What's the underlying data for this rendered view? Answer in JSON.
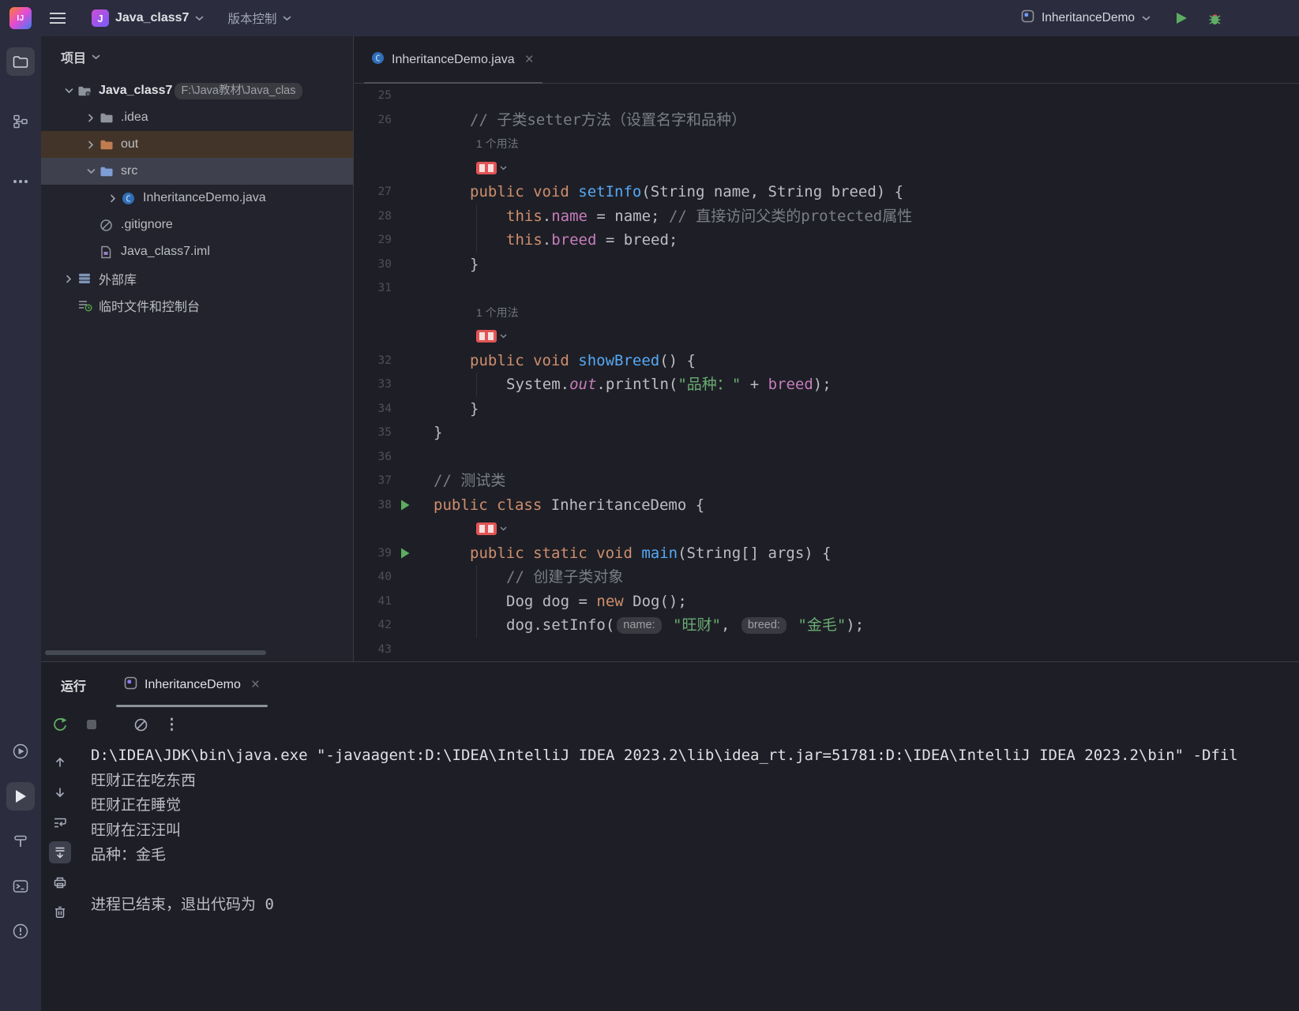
{
  "topbar": {
    "project": {
      "avatar_letter": "J",
      "label": "Java_class7"
    },
    "vcs_label": "版本控制",
    "run_widget": {
      "config_label": "InheritanceDemo"
    }
  },
  "tool_strip": {
    "top_icons": [
      "project-folder",
      "structure",
      "more-horizontal"
    ],
    "bottom_icons": [
      "services",
      "run",
      "build-hammer",
      "terminal",
      "problems"
    ]
  },
  "project_panel": {
    "title": "项目",
    "tree": [
      {
        "label": "Java_class7",
        "hint": "F:\\Java教材\\Java_clas",
        "icon": "folder-project",
        "chevron": "down",
        "indent": 0,
        "bold": true
      },
      {
        "label": ".idea",
        "icon": "folder",
        "chevron": "right",
        "indent": 1
      },
      {
        "label": "out",
        "icon": "folder-excluded",
        "chevron": "right",
        "indent": 1,
        "highlight": "hover"
      },
      {
        "label": "src",
        "icon": "folder-src",
        "chevron": "down",
        "indent": 1,
        "highlight": "selected"
      },
      {
        "label": "InheritanceDemo.java",
        "icon": "java-class",
        "chevron": "right",
        "indent": 2
      },
      {
        "label": ".gitignore",
        "icon": "gitignore",
        "indent": 1
      },
      {
        "label": "Java_class7.iml",
        "icon": "module-file",
        "indent": 1
      },
      {
        "label": "外部库",
        "icon": "libraries",
        "chevron": "right",
        "indent": 0
      },
      {
        "label": "临时文件和控制台",
        "icon": "scratches",
        "indent": 0
      }
    ]
  },
  "editor": {
    "tab": {
      "label": "InheritanceDemo.java"
    },
    "usage_hint": "1 个用法",
    "lines": [
      {
        "type": "code",
        "num": "25",
        "indent": 0,
        "tokens": []
      },
      {
        "type": "code",
        "num": "26",
        "indent": 1,
        "tokens": [
          [
            "co",
            "// 子类setter方法（设置名字和品种）"
          ]
        ]
      },
      {
        "type": "usage",
        "indent": 1
      },
      {
        "type": "badge",
        "indent": 1
      },
      {
        "type": "code",
        "num": "27",
        "indent": 1,
        "tokens": [
          [
            "kw",
            "public void "
          ],
          [
            "me",
            "setInfo"
          ],
          [
            "pl",
            "(String name, String breed) {"
          ]
        ]
      },
      {
        "type": "code",
        "num": "28",
        "indent": 2,
        "tokens": [
          [
            "kw",
            "this"
          ],
          [
            "pl",
            "."
          ],
          [
            "fi",
            "name"
          ],
          [
            "pl",
            " = name; "
          ],
          [
            "co",
            "// 直接访问父类的protected属性"
          ]
        ]
      },
      {
        "type": "code",
        "num": "29",
        "indent": 2,
        "tokens": [
          [
            "kw",
            "this"
          ],
          [
            "pl",
            "."
          ],
          [
            "fi",
            "breed"
          ],
          [
            "pl",
            " = breed;"
          ]
        ]
      },
      {
        "type": "code",
        "num": "30",
        "indent": 1,
        "tokens": [
          [
            "pl",
            "}"
          ]
        ]
      },
      {
        "type": "code",
        "num": "31",
        "indent": 0,
        "tokens": []
      },
      {
        "type": "usage",
        "indent": 1
      },
      {
        "type": "badge",
        "indent": 1
      },
      {
        "type": "code",
        "num": "32",
        "indent": 1,
        "tokens": [
          [
            "kw",
            "public void "
          ],
          [
            "me",
            "showBreed"
          ],
          [
            "pl",
            "() {"
          ]
        ]
      },
      {
        "type": "code",
        "num": "33",
        "indent": 2,
        "tokens": [
          [
            "pl",
            "System."
          ],
          [
            "fo",
            "out"
          ],
          [
            "pl",
            ".println("
          ],
          [
            "st",
            "\"品种："
          ],
          [
            "st",
            "\""
          ],
          [
            "pl",
            " + "
          ],
          [
            "fi",
            "breed"
          ],
          [
            "pl",
            ");"
          ]
        ]
      },
      {
        "type": "code",
        "num": "34",
        "indent": 1,
        "tokens": [
          [
            "pl",
            "}"
          ]
        ]
      },
      {
        "type": "code",
        "num": "35",
        "indent": 0,
        "tokens": [
          [
            "pl",
            "}"
          ]
        ]
      },
      {
        "type": "code",
        "num": "36",
        "indent": 0,
        "tokens": []
      },
      {
        "type": "code",
        "num": "37",
        "indent": 0,
        "tokens": [
          [
            "co",
            "// 测试类"
          ]
        ]
      },
      {
        "type": "code",
        "num": "38",
        "indent": 0,
        "run": true,
        "tokens": [
          [
            "kw",
            "public class "
          ],
          [
            "pl",
            "InheritanceDemo {"
          ]
        ]
      },
      {
        "type": "badge",
        "indent": 1
      },
      {
        "type": "code",
        "num": "39",
        "indent": 1,
        "run": true,
        "tokens": [
          [
            "kw",
            "public static void "
          ],
          [
            "me",
            "main"
          ],
          [
            "pl",
            "(String[] args) {"
          ]
        ]
      },
      {
        "type": "code",
        "num": "40",
        "indent": 2,
        "tokens": [
          [
            "co",
            "// 创建子类对象"
          ]
        ]
      },
      {
        "type": "code",
        "num": "41",
        "indent": 2,
        "tokens": [
          [
            "pl",
            "Dog dog = "
          ],
          [
            "kw",
            "new"
          ],
          [
            "pl",
            " Dog();"
          ]
        ]
      },
      {
        "type": "code",
        "num": "42",
        "indent": 2,
        "tokens": [
          [
            "pl",
            "dog.setInfo("
          ],
          [
            "hint",
            "name:"
          ],
          [
            "pl",
            " "
          ],
          [
            "st",
            "\"旺财\""
          ],
          [
            "pl",
            ", "
          ],
          [
            "hint",
            "breed:"
          ],
          [
            "pl",
            " "
          ],
          [
            "st",
            "\"金毛\""
          ],
          [
            "pl",
            ");"
          ]
        ]
      },
      {
        "type": "code",
        "num": "43",
        "indent": 0,
        "tokens": []
      }
    ]
  },
  "run_panel": {
    "title": "运行",
    "tab": {
      "label": "InheritanceDemo"
    },
    "console_lines": [
      {
        "text": "D:\\IDEA\\JDK\\bin\\java.exe \"-javaagent:D:\\IDEA\\IntelliJ IDEA 2023.2\\lib\\idea_rt.jar=51781:D:\\IDEA\\IntelliJ IDEA 2023.2\\bin\" -Dfil",
        "cls": "cmd"
      },
      {
        "text": "旺财正在吃东西"
      },
      {
        "text": "旺财正在睡觉"
      },
      {
        "text": "旺财在汪汪叫"
      },
      {
        "text": "品种：金毛"
      },
      {
        "text": ""
      },
      {
        "text": "进程已结束，退出代码为 0"
      }
    ]
  },
  "colors": {
    "topbar_bg": "#2B2C3E",
    "panel_bg": "#22232C",
    "editor_bg": "#1E1F26",
    "keyword": "#CF8E6D",
    "method_decl": "#56A8F5",
    "field": "#C77DBB",
    "string": "#6AAB73",
    "comment": "#7A7E85",
    "editor_fg": "#BCBEC4",
    "run_green": "#5CAD5F",
    "badge_red": "#E25454",
    "selected_row": "#3E414D",
    "hover_row": "#433429"
  },
  "icons": {
    "idea-logo-icon": "gradient-rounded-square-IJ",
    "hamburger-icon": "three-bars",
    "chevron-down-icon": "v-chevron",
    "chevron-right-icon": "right-chevron",
    "close-icon": "×",
    "run-icon": "green-play-triangle",
    "debug-icon": "bug",
    "rerun-icon": "circular-arrow",
    "stop-icon": "gray-rounded-square",
    "more-vertical-icon": "⋮",
    "red-author-badge-icon": "red-rect-white-glyphs"
  }
}
